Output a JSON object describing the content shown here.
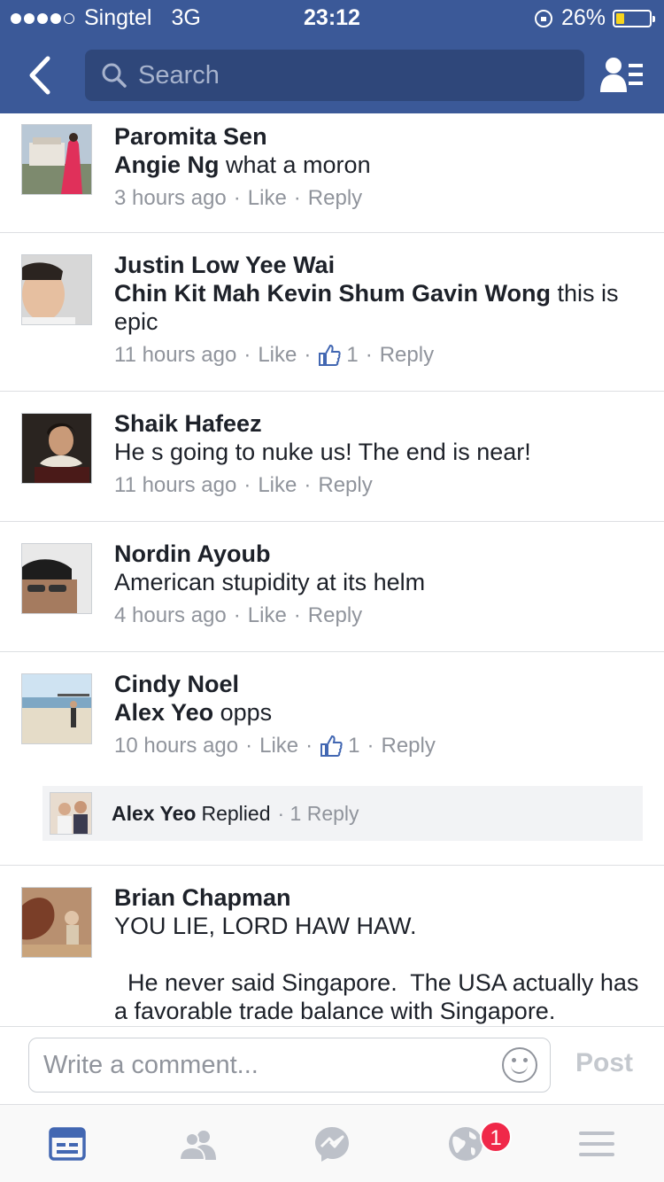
{
  "status_bar": {
    "carrier": "Singtel",
    "network": "3G",
    "time": "23:12",
    "battery": "26%",
    "battery_level": 0.26,
    "signal_bars": 4
  },
  "nav": {
    "search_placeholder": "Search",
    "back_icon": "chevron-left-icon",
    "friends_icon": "friend-requests-icon"
  },
  "comments": [
    {
      "author": "Paromita Sen",
      "tagged": "Angie Ng",
      "text": " what a moron",
      "time": "3 hours ago",
      "like_label": "Like",
      "reply_label": "Reply",
      "likes": ""
    },
    {
      "author": "Justin Low Yee Wai",
      "tagged": "Chin Kit Mah Kevin Shum Gavin Wong",
      "text": " this is epic",
      "time": "11 hours ago",
      "like_label": "Like",
      "reply_label": "Reply",
      "likes": "1"
    },
    {
      "author": "Shaik Hafeez",
      "tagged": "",
      "text": "He s going to nuke us! The end is near!",
      "time": "11 hours ago",
      "like_label": "Like",
      "reply_label": "Reply",
      "likes": ""
    },
    {
      "author": "Nordin Ayoub",
      "tagged": "",
      "text": "American stupidity at its helm",
      "time": "4 hours ago",
      "like_label": "Like",
      "reply_label": "Reply",
      "likes": ""
    },
    {
      "author": "Cindy Noel",
      "tagged": "Alex Yeo",
      "text": " opps",
      "time": "10 hours ago",
      "like_label": "Like",
      "reply_label": "Reply",
      "likes": "1",
      "reply_summary": {
        "name": "Alex Yeo",
        "verb": "Replied",
        "count": "1 Reply"
      }
    },
    {
      "author": "Brian Chapman",
      "tagged": "",
      "text": "YOU LIE, LORD HAW HAW.",
      "text2": "  He never said Singapore.  The USA actually has a favorable trade balance with Singapore."
    }
  ],
  "composer": {
    "placeholder": "Write a comment...",
    "post_label": "Post"
  },
  "tabbar": {
    "items": [
      "news-feed-icon",
      "friends-icon",
      "messenger-icon",
      "notifications-globe-icon",
      "menu-icon"
    ],
    "notification_badge": "1",
    "active": "news-feed-icon"
  },
  "colors": {
    "brand": "#3b5998",
    "meta": "#90949c",
    "like_blue": "#4267b2",
    "badge": "#f02849"
  }
}
